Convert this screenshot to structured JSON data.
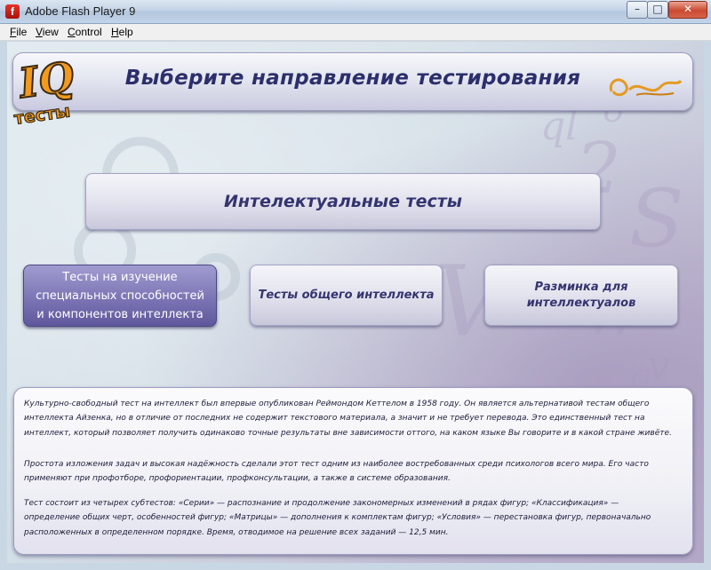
{
  "window": {
    "title": "Adobe Flash Player 9",
    "app_icon_glyph": "f",
    "controls": {
      "minimize": "–",
      "maximize": "□",
      "close": "✕"
    }
  },
  "menu": {
    "file": {
      "accel": "F",
      "rest": "ile"
    },
    "view": {
      "accel": "V",
      "rest": "iew"
    },
    "control": {
      "accel": "C",
      "rest": "ontrol"
    },
    "help": {
      "accel": "H",
      "rest": "elp"
    }
  },
  "header": {
    "title": "Выберите направление тестирования",
    "logo_iq": "IQ",
    "logo_sub": "тесты"
  },
  "buttons": {
    "intellect": "Интелектуальные тесты",
    "special": [
      "Тесты на изучение",
      "специальных способностей",
      "и  компонентов интеллекта"
    ],
    "general": "Тесты общего интеллекта",
    "warmup": [
      "Разминка для",
      "интеллектуалов"
    ]
  },
  "description": {
    "paragraphs": [
      "Культурно-свободный тест на интеллект был впервые опубликован Реймондом Кеттелом в 1958 году. Он является  альтернативой тестам общего интеллекта Айзенка, но в отличие от последних не содержит текстового материала, а значит и не требует перевода. Это единственный тест на интеллект, который позволяет получить одинаково точные результаты вне зависимости оттого, на каком языке Вы говорите и в какой стране живёте.",
      "Простота изложения задач и высокая надёжность сделали этот тест одним из наиболее востребованных среди психологов всего мира. Его часто применяют при профотборе, профориентации, профконсультации, а также в системе образования.",
      "Тест состоит из четырех субтестов: «Серии» — распознание и продолжение закономерных изменений в рядах фигур; «Классификация» — определение общих черт, особенностей фигур; «Матрицы» — дополнения к комплектам фигур; «Условия» — перестановка фигур, первоначально расположенных в определенном порядке. Время, отводимое на решение всех заданий — 12,5 мин."
    ]
  },
  "colors": {
    "accent_purple": "#7b75b5",
    "title_text": "#2c2f6b",
    "logo_orange": "#f29a1e"
  },
  "icons": [
    "flash-app-icon",
    "iq-tests-logo",
    "brand-logo"
  ]
}
